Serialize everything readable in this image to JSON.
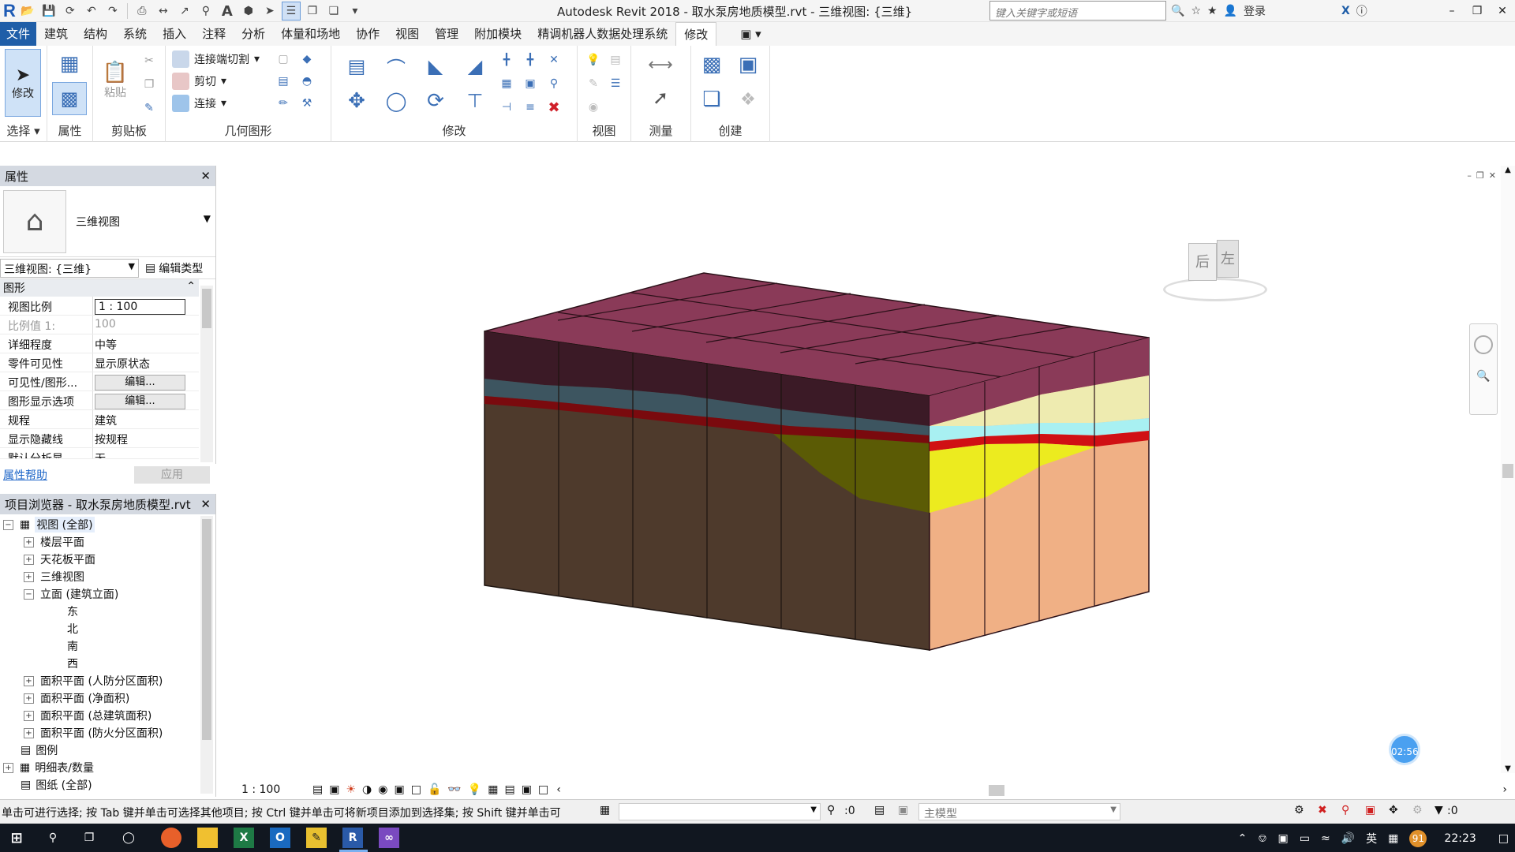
{
  "app": {
    "title": "Autodesk Revit 2018 -    取水泵房地质模型.rvt - 三维视图: {三维}",
    "search_placeholder": "键入关键字或短语",
    "login": "登录",
    "logo": "R"
  },
  "menu": {
    "tabs": [
      "文件",
      "建筑",
      "结构",
      "系统",
      "插入",
      "注释",
      "分析",
      "体量和场地",
      "协作",
      "视图",
      "管理",
      "附加模块",
      "精调机器人数据处理系统",
      "修改"
    ],
    "active": "修改"
  },
  "ribbon": {
    "select_label": "修改",
    "select_panel": "选择",
    "properties_panel": "属性",
    "clipboard_panel": "剪贴板",
    "paste_label": "粘贴",
    "geometry_panel": "几何图形",
    "geometry_items": [
      "连接端切割",
      "剪切",
      "连接"
    ],
    "modify_panel": "修改",
    "view_panel": "视图",
    "measure_panel": "测量",
    "create_panel": "创建"
  },
  "properties": {
    "header": "属性",
    "type_name": "三维视图",
    "selector": "三维视图: {三维}",
    "edit_type": "编辑类型",
    "group": "图形",
    "rows": [
      {
        "k": "视图比例",
        "v": "1 : 100"
      },
      {
        "k": "比例值 1:",
        "v": "100"
      },
      {
        "k": "详细程度",
        "v": "中等"
      },
      {
        "k": "零件可见性",
        "v": "显示原状态"
      },
      {
        "k": "可见性/图形...",
        "v": "编辑..."
      },
      {
        "k": "图形显示选项",
        "v": "编辑..."
      },
      {
        "k": "规程",
        "v": "建筑"
      },
      {
        "k": "显示隐藏线",
        "v": "按规程"
      },
      {
        "k": "默认分析显示...",
        "v": "无"
      }
    ],
    "help": "属性帮助",
    "apply": "应用"
  },
  "browser": {
    "header": "项目浏览器 - 取水泵房地质模型.rvt",
    "items": [
      "视图 (全部)",
      "楼层平面",
      "天花板平面",
      "三维视图",
      "立面 (建筑立面)",
      "东",
      "北",
      "南",
      "西",
      "面积平面 (人防分区面积)",
      "面积平面 (净面积)",
      "面积平面 (总建筑面积)",
      "面积平面 (防火分区面积)",
      "图例",
      "明细表/数量",
      "图纸 (全部)"
    ]
  },
  "viewcube": {
    "faces": [
      "后",
      "左"
    ]
  },
  "view": {
    "scale": "1 : 100",
    "timer": "02:56"
  },
  "status": {
    "message": "单击可进行选择; 按 Tab 键并单击可选择其他项目; 按 Ctrl 键并单击可将新项目添加到选择集; 按 Shift 键并单击可",
    "count_a": ":0",
    "model": "主模型",
    "count_b": ":0"
  },
  "taskbar": {
    "time": "22:23",
    "ime": "英",
    "badge": "91"
  },
  "colors": {
    "accent": "#1f5ea8",
    "top_face": "#8a3a58",
    "front_upper": "#3b1a26",
    "front_lower": "#4e3a2c",
    "side_upper": "#8a3a58",
    "side_lower": "#f0b085",
    "yellow": "#eceb1f",
    "olive": "#5b5b05",
    "pale": "#eeebb0",
    "cyan": "#a8f0f2",
    "red": "#d01014",
    "slate": "#3d5560"
  }
}
